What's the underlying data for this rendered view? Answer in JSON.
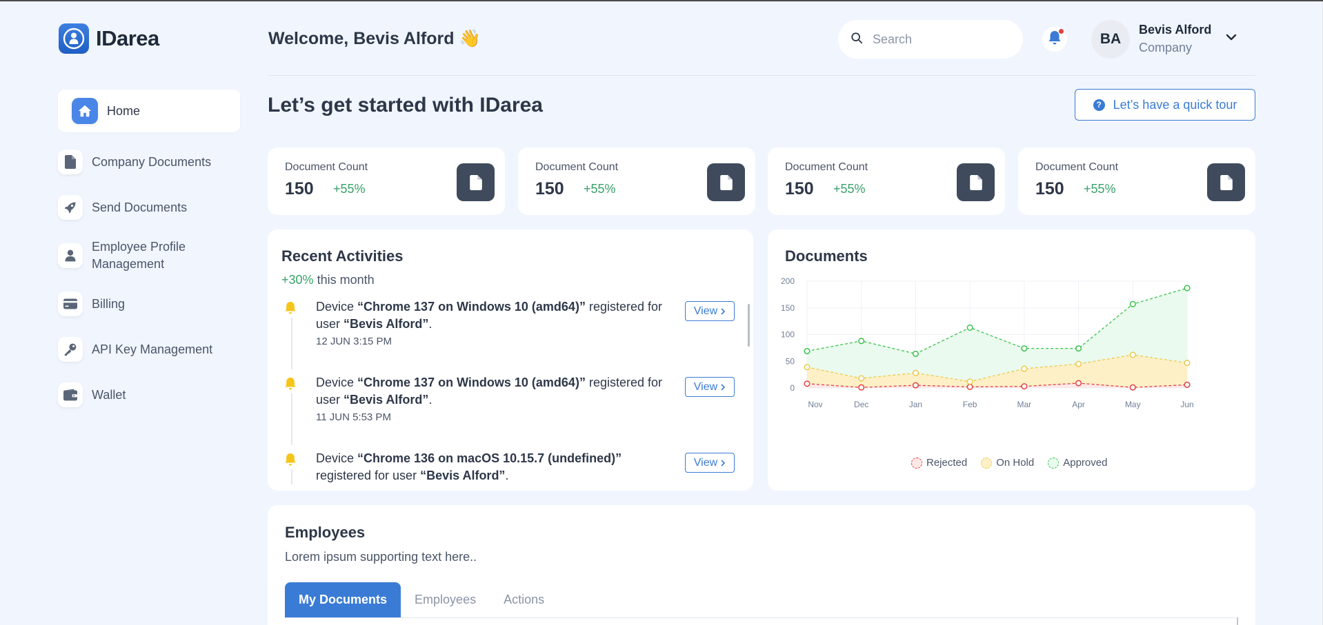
{
  "brand": {
    "name": "IDarea"
  },
  "sidebar": {
    "items": [
      {
        "label": "Home",
        "icon": "home-icon"
      },
      {
        "label": "Company Documents",
        "icon": "document-icon"
      },
      {
        "label": "Send Documents",
        "icon": "rocket-icon"
      },
      {
        "label": "Employee Profile Management",
        "icon": "user-icon"
      },
      {
        "label": "Billing",
        "icon": "credit-card-icon"
      },
      {
        "label": "API Key Management",
        "icon": "key-icon"
      },
      {
        "label": "Wallet",
        "icon": "wallet-icon"
      }
    ]
  },
  "header": {
    "welcome": "Welcome, Bevis Alford 👋",
    "search_placeholder": "Search",
    "user": {
      "initials": "BA",
      "name": "Bevis Alford",
      "role": "Company"
    }
  },
  "main": {
    "title": "Let’s get started with IDarea",
    "tour_button": "Let’s have a quick tour",
    "stats": [
      {
        "label": "Document Count",
        "value": "150",
        "change": "+55%"
      },
      {
        "label": "Document Count",
        "value": "150",
        "change": "+55%"
      },
      {
        "label": "Document Count",
        "value": "150",
        "change": "+55%"
      },
      {
        "label": "Document Count",
        "value": "150",
        "change": "+55%"
      }
    ]
  },
  "activities": {
    "title": "Recent Activities",
    "change": "+30%",
    "period": "this month",
    "view_label": "View",
    "items": [
      {
        "prefix": "Device ",
        "device": "“Chrome 137 on Windows 10 (amd64)”",
        "middle": " registered for user ",
        "user": "“Bevis Alford”",
        "suffix": ".",
        "time": "12 JUN 3:15 PM"
      },
      {
        "prefix": "Device ",
        "device": "“Chrome 137 on Windows 10 (amd64)”",
        "middle": " registered for user ",
        "user": "“Bevis Alford”",
        "suffix": ".",
        "time": "11 JUN 5:53 PM"
      },
      {
        "prefix": "Device ",
        "device": "“Chrome 136 on macOS 10.15.7 (undefined)”",
        "middle": " registered for user ",
        "user": "“Bevis Alford”",
        "suffix": ".",
        "time": ""
      }
    ]
  },
  "documents": {
    "title": "Documents"
  },
  "chart_data": {
    "type": "area",
    "title": "Documents",
    "categories": [
      "Nov",
      "Dec",
      "Jan",
      "Feb",
      "Mar",
      "Apr",
      "May",
      "Jun"
    ],
    "ylim": [
      0,
      200
    ],
    "yticks": [
      0,
      50,
      100,
      150,
      200
    ],
    "grid": true,
    "legend": "bottom",
    "series": [
      {
        "name": "Rejected",
        "color": "#e53e3e",
        "fill": "#fde8e8",
        "values": [
          8,
          1,
          5,
          2,
          3,
          9,
          1,
          6
        ]
      },
      {
        "name": "On Hold",
        "color": "#ecc94b",
        "fill": "#fdf0c7",
        "values": [
          39,
          18,
          28,
          12,
          36,
          45,
          62,
          47
        ]
      },
      {
        "name": "Approved",
        "color": "#38c24a",
        "fill": "#eafaee",
        "values": [
          69,
          88,
          64,
          113,
          74,
          74,
          157,
          187
        ]
      }
    ]
  },
  "employees": {
    "title": "Employees",
    "subtitle": "Lorem ipsum supporting text here..",
    "tabs": [
      "My Documents",
      "Employees",
      "Actions"
    ]
  }
}
